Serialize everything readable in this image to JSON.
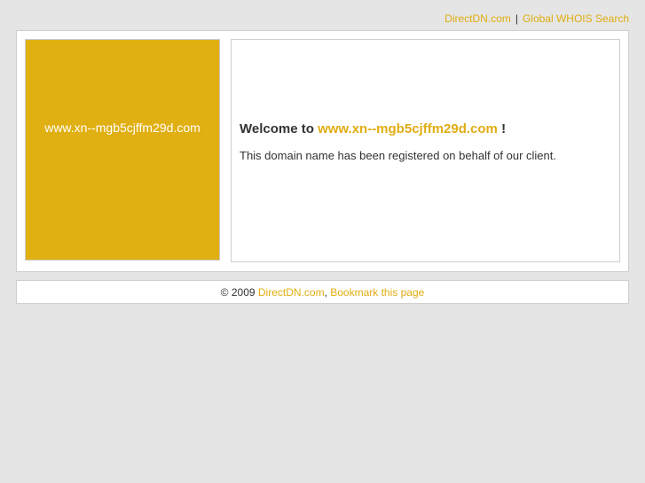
{
  "header": {
    "link_directdn": "DirectDN.com",
    "separator": "|",
    "link_whois": "Global WHOIS Search"
  },
  "domain_panel": {
    "domain": "www.xn--mgb5cjffm29d.com"
  },
  "content": {
    "welcome_prefix": "Welcome to",
    "domain": "www.xn--mgb5cjffm29d.com",
    "welcome_suffix": "!",
    "description": "This domain name has been registered on behalf of our client."
  },
  "footer": {
    "copyright": "© 2009",
    "link_directdn": "DirectDN.com",
    "comma": ",",
    "link_bookmark": "Bookmark this page"
  },
  "colors": {
    "accent": "#e0ad12",
    "background": "#e5e5e5",
    "text": "#333333"
  }
}
